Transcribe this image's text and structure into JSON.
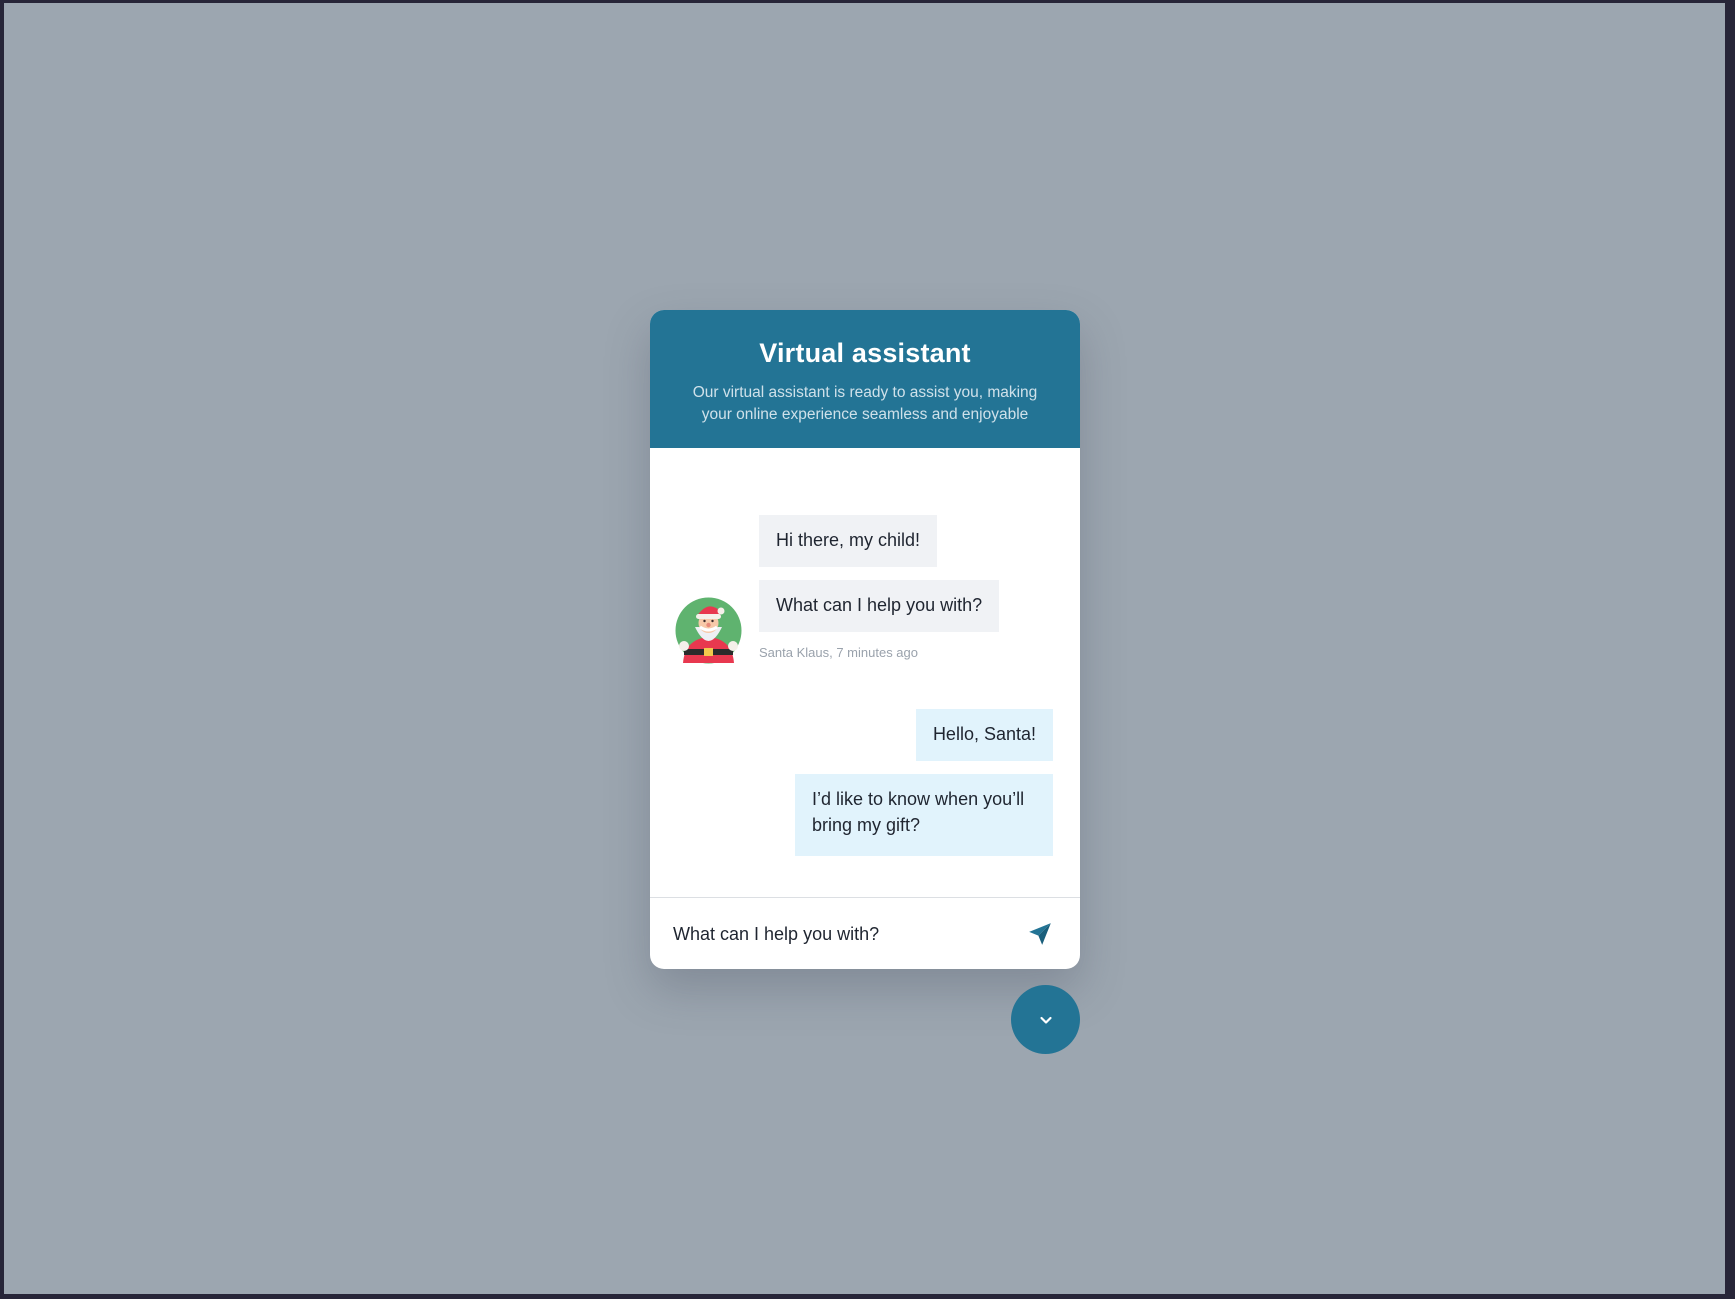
{
  "colors": {
    "backdrop": "#9ca6b0",
    "brand": "#237495",
    "bot_bubble": "#f0f2f5",
    "user_bubble": "#e1f3fc"
  },
  "header": {
    "title": "Virtual assistant",
    "subtitle": "Our virtual assistant is ready to assist you, making your online experience seamless and enjoyable"
  },
  "conversation": {
    "bot_messages": [
      "Hi there, my child!",
      "What can I help you with?"
    ],
    "bot_meta": "Santa Klaus, 7 minutes ago",
    "bot_avatar_icon": "santa-claus-avatar-icon",
    "user_messages": [
      "Hello, Santa!",
      "I’d like to know when you’ll bring my gift?"
    ]
  },
  "composer": {
    "placeholder": "What can I help you with?",
    "send_icon": "send-paper-plane-icon"
  },
  "launcher": {
    "icon": "chevron-down-icon"
  }
}
